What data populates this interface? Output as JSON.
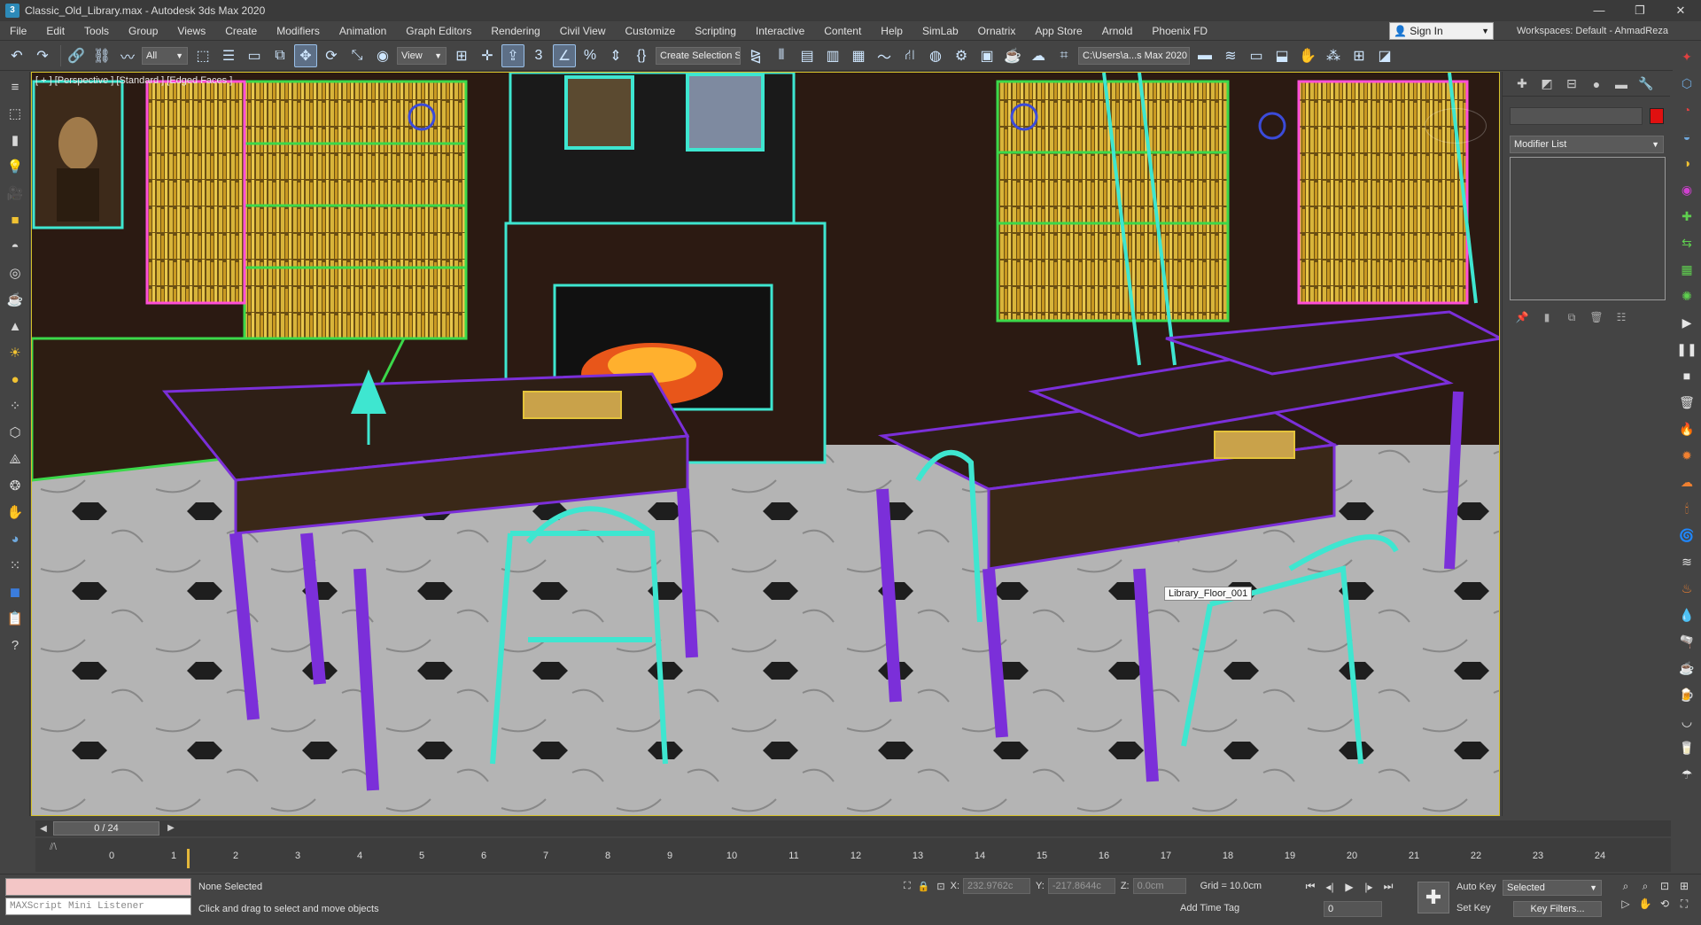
{
  "window": {
    "title": "Classic_Old_Library.max - Autodesk 3ds Max 2020",
    "controls": [
      "—",
      "❐",
      "✕"
    ]
  },
  "menubar": {
    "items": [
      "File",
      "Edit",
      "Tools",
      "Group",
      "Views",
      "Create",
      "Modifiers",
      "Animation",
      "Graph Editors",
      "Rendering",
      "Civil View",
      "Customize",
      "Scripting",
      "Interactive",
      "Content",
      "Help",
      "SimLab",
      "Ornatrix",
      "App Store",
      "Arnold",
      "Phoenix FD"
    ],
    "sign_in": "Sign In",
    "workspaces": "Workspaces: Default - AhmadReza"
  },
  "toolbar": {
    "selection_filter": "All",
    "ref_coord": "View",
    "named_selection": "Create Selection Se",
    "project_path": "C:\\Users\\a...s Max 2020"
  },
  "viewport": {
    "label": "[ + ] [Perspective ] [Standard ] [Edged Faces ]",
    "tooltip": "Library_Floor_001"
  },
  "command_panel": {
    "modifier_list": "Modifier List",
    "object_color": "#e01010"
  },
  "timeline": {
    "frame_display": "0 / 24",
    "ticks": [
      "0",
      "1",
      "2",
      "3",
      "4",
      "5",
      "6",
      "7",
      "8",
      "9",
      "10",
      "11",
      "12",
      "13",
      "14",
      "15",
      "16",
      "17",
      "18",
      "19",
      "20",
      "21",
      "22",
      "23",
      "24"
    ]
  },
  "status": {
    "listener_placeholder": "MAXScript Mini Listener",
    "selection": "None Selected",
    "prompt": "Click and drag to select and move objects",
    "x_label": "X:",
    "x_value": "232.9762c",
    "y_label": "Y:",
    "y_value": "-217.8644c",
    "z_label": "Z:",
    "z_value": "0.0cm",
    "grid": "Grid = 10.0cm",
    "add_time_tag": "Add Time Tag",
    "frame_value": "0",
    "auto_key": "Auto Key",
    "set_key": "Set Key",
    "key_mode": "Selected",
    "key_filters": "Key Filters..."
  },
  "colors": {
    "viewport_border": "#d6c22a",
    "wire_cyan": "#3ee6d0",
    "wire_purple": "#7b2fd9",
    "wire_yellow": "#e4c33a",
    "wire_magenta": "#ff4fd8",
    "wire_green": "#3bd84a"
  }
}
